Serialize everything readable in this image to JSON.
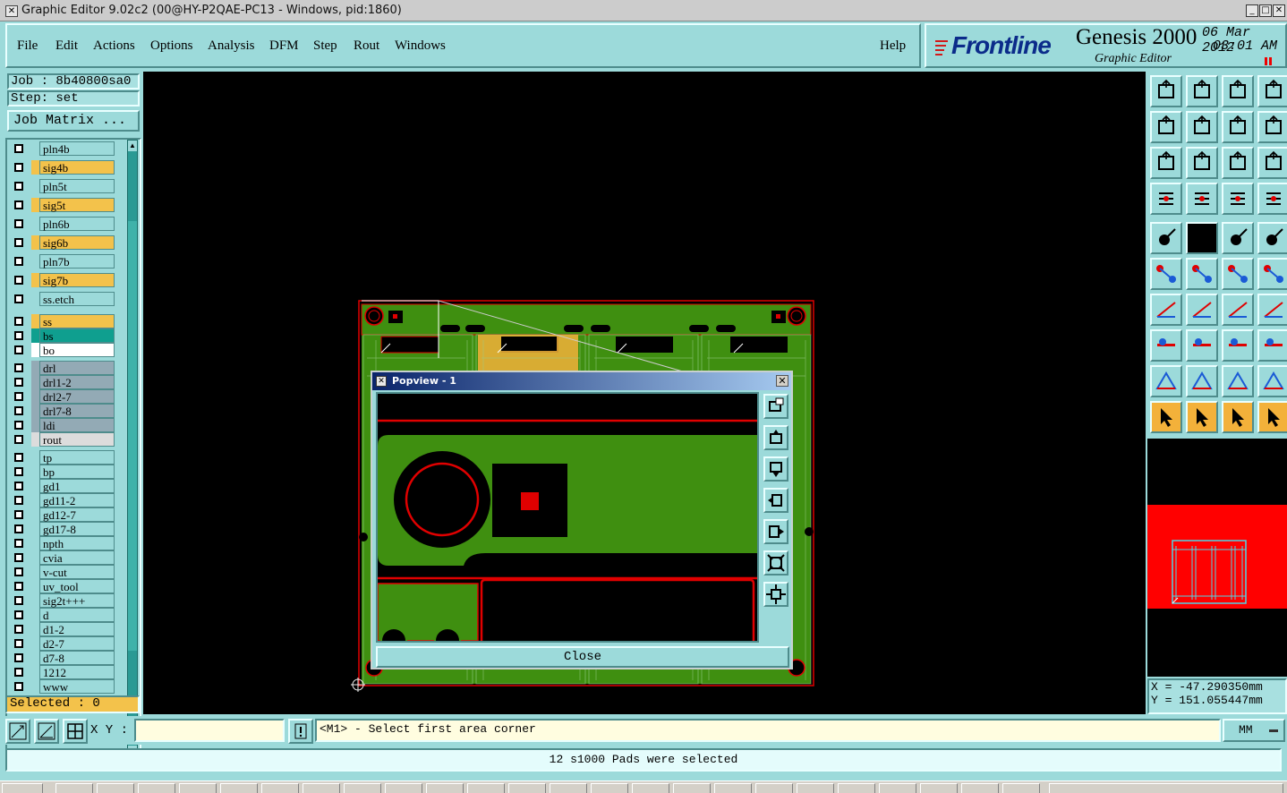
{
  "window": {
    "title": "Graphic Editor 9.02c2 (00@HY-P2QAE-PC13 - Windows, pid:1860)"
  },
  "menu": {
    "items": [
      "File",
      "Edit",
      "Actions",
      "Options",
      "Analysis",
      "DFM",
      "Step",
      "Rout",
      "Windows"
    ],
    "help": "Help"
  },
  "brand": {
    "logo": "Frontline",
    "product": "Genesis 2000",
    "subtitle": "Graphic Editor",
    "date": "06 Mar 2012",
    "time": "03:01 AM"
  },
  "job": {
    "job": "Job : 8b40800sa0",
    "step": "Step: set",
    "matrix_button": "Job Matrix ..."
  },
  "layers": [
    {
      "name": "pln4b",
      "color": "#9cdada"
    },
    {
      "name": "sig4b",
      "color": "#f3c24b"
    },
    {
      "name": "pln5t",
      "color": "#9cdada"
    },
    {
      "name": "sig5t",
      "color": "#f3c24b"
    },
    {
      "name": "pln6b",
      "color": "#9cdada"
    },
    {
      "name": "sig6b",
      "color": "#f3c24b"
    },
    {
      "name": "pln7b",
      "color": "#9cdada"
    },
    {
      "name": "sig7b",
      "color": "#f3c24b"
    },
    {
      "name": "ss.etch",
      "color": "#9cdada"
    },
    {
      "name": "ss",
      "color": "#f3c24b"
    },
    {
      "name": "bs",
      "color": "#0f9f8f"
    },
    {
      "name": "bo",
      "color": "#ffffff"
    },
    {
      "name": "drl",
      "color": "#93aab5"
    },
    {
      "name": "drl1-2",
      "color": "#93aab5"
    },
    {
      "name": "drl2-7",
      "color": "#93aab5"
    },
    {
      "name": "drl7-8",
      "color": "#93aab5"
    },
    {
      "name": "ldi",
      "color": "#93aab5"
    },
    {
      "name": "rout",
      "color": "#dcdcdc"
    },
    {
      "name": "tp",
      "color": "#9cdada"
    },
    {
      "name": "bp",
      "color": "#9cdada"
    },
    {
      "name": "gd1",
      "color": "#9cdada"
    },
    {
      "name": "gd11-2",
      "color": "#9cdada"
    },
    {
      "name": "gd12-7",
      "color": "#9cdada"
    },
    {
      "name": "gd17-8",
      "color": "#9cdada"
    },
    {
      "name": "npth",
      "color": "#9cdada"
    },
    {
      "name": "cvia",
      "color": "#9cdada"
    },
    {
      "name": "v-cut",
      "color": "#9cdada"
    },
    {
      "name": "uv_tool",
      "color": "#9cdada"
    },
    {
      "name": "sig2t+++",
      "color": "#9cdada"
    },
    {
      "name": "d",
      "color": "#9cdada"
    },
    {
      "name": "d1-2",
      "color": "#9cdada"
    },
    {
      "name": "d2-7",
      "color": "#9cdada"
    },
    {
      "name": "d7-8",
      "color": "#9cdada"
    },
    {
      "name": "1212",
      "color": "#9cdada"
    },
    {
      "name": "www",
      "color": "#9cdada"
    }
  ],
  "selected": "Selected : 0",
  "popview": {
    "title": "Popview - 1",
    "close": "Close"
  },
  "coords": {
    "x": "X = -47.290350mm",
    "y": "Y = 151.055447mm"
  },
  "command": {
    "xy_label": "X Y :",
    "xy_value": "",
    "prompt": "<M1> - Select first area corner",
    "units": "MM"
  },
  "status": "12 s1000 Pads were selected",
  "colors": {
    "panel": "#9cdada",
    "board": "#3f8f10",
    "outline": "#e00000",
    "highlight": "#f3b13a"
  }
}
